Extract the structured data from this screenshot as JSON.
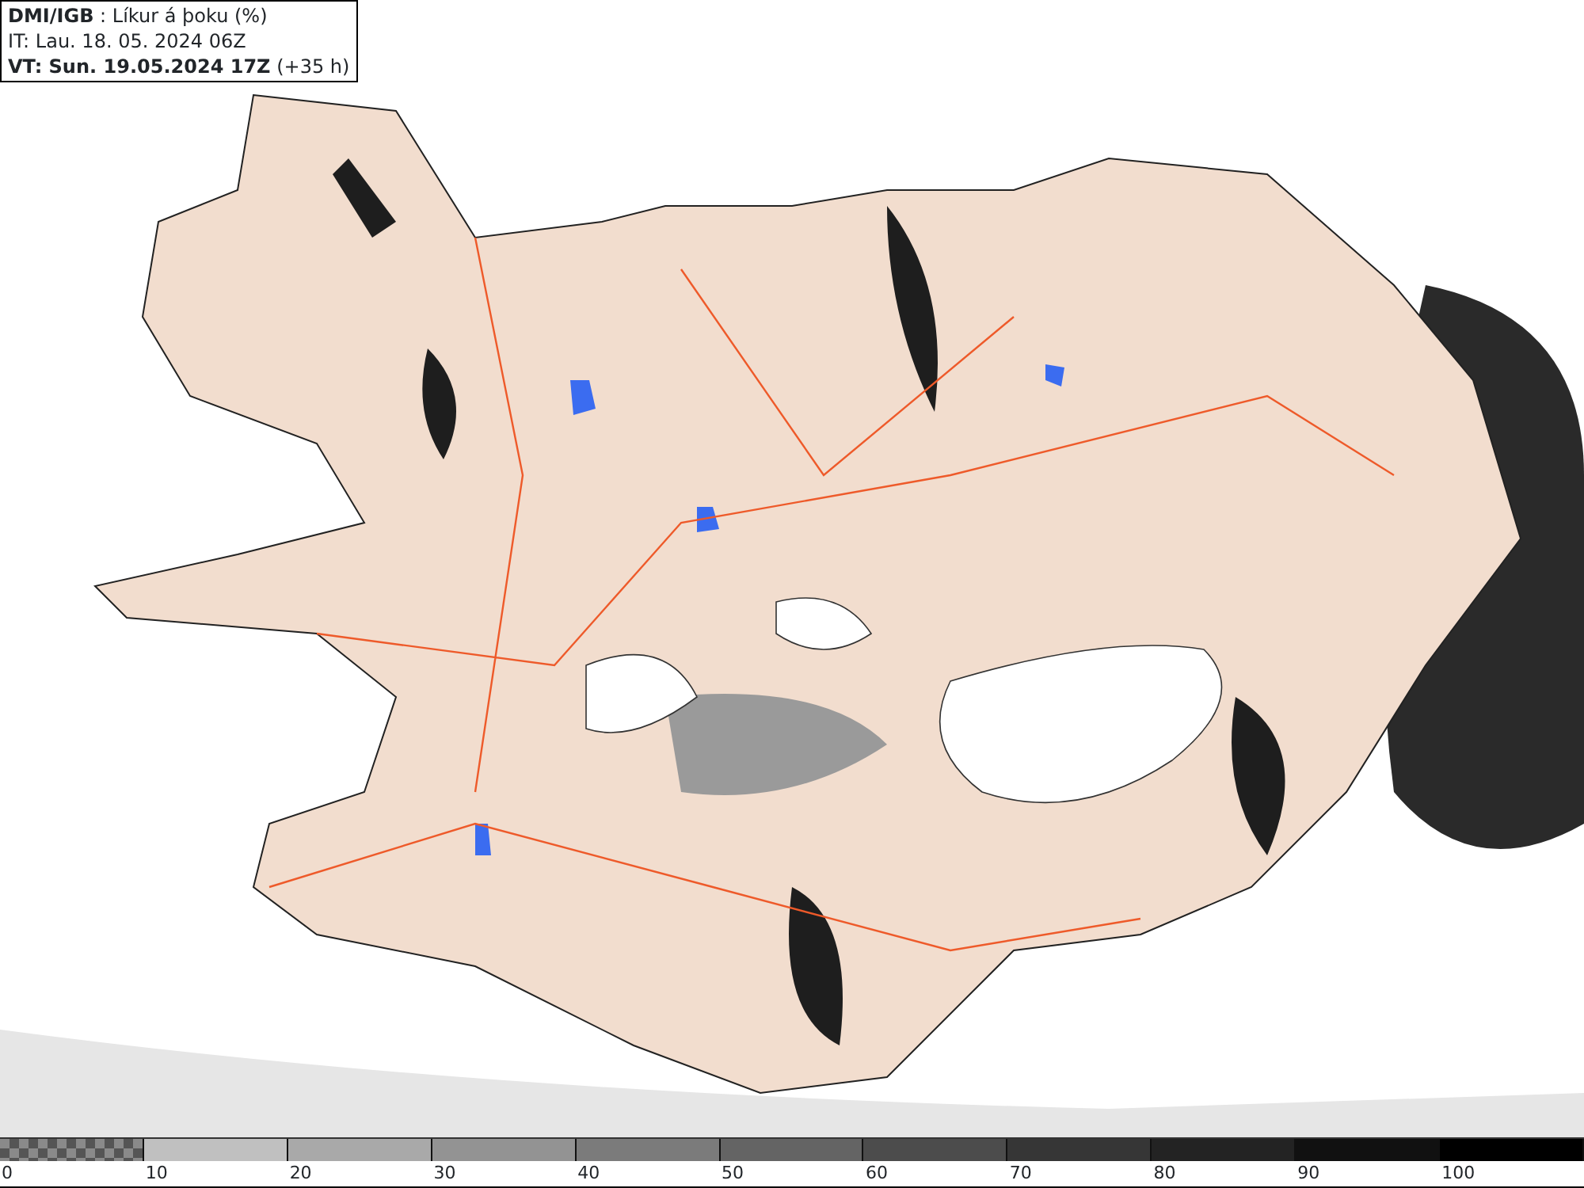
{
  "header": {
    "source": "DMI/IGB",
    "title": ": Líkur á þoku (%)",
    "issued": "IT: Lau. 18. 05. 2024 06Z",
    "valid": "VT: Sun. 19.05.2024 17Z",
    "offset": "(+35 h)"
  },
  "legend": {
    "swatches": [
      {
        "kind": "checker",
        "color": "#555555"
      },
      {
        "kind": "solid",
        "color": "#c0c0c0"
      },
      {
        "kind": "solid",
        "color": "#a9a9a9"
      },
      {
        "kind": "solid",
        "color": "#939393"
      },
      {
        "kind": "solid",
        "color": "#7b7b7b"
      },
      {
        "kind": "solid",
        "color": "#646464"
      },
      {
        "kind": "solid",
        "color": "#4c4c4c"
      },
      {
        "kind": "solid",
        "color": "#363636"
      },
      {
        "kind": "solid",
        "color": "#232323"
      },
      {
        "kind": "solid",
        "color": "#111111"
      },
      {
        "kind": "solid",
        "color": "#000000"
      }
    ],
    "labels": [
      "0",
      "10",
      "20",
      "30",
      "40",
      "50",
      "60",
      "70",
      "80",
      "90",
      "100"
    ]
  }
}
